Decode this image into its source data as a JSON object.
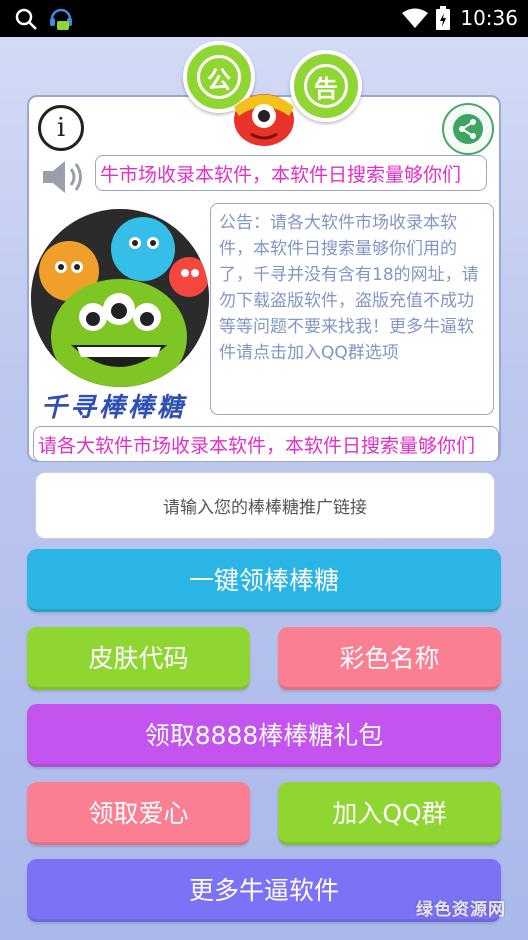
{
  "statusbar": {
    "time": "10:36",
    "icons": [
      "search-icon",
      "notification-bot-icon",
      "wifi-icon",
      "battery-icon"
    ]
  },
  "badges": {
    "left": "公",
    "right": "告"
  },
  "marquee_text": "请各大软件市场收录本软件，本软件日搜索量够你们用的了",
  "marquee_top_visible": "牛市场收录本软件，本软件日搜索量够你们",
  "marquee_bottom_visible": "请各大软件市场收录本软件，本软件日搜索量够你们",
  "logo": {
    "caption": "千寻棒棒糖"
  },
  "notice_text": "公告：请各大软件市场收录本软件，本软件日搜索量够你们用的了，千寻并没有含有18的网址，请勿下载盗版软件，盗版充值不成功等等问题不要来找我！更多牛逼软件请点击加入QQ群选项",
  "input": {
    "placeholder": "请输入您的棒棒糖推广链接"
  },
  "buttons": {
    "claim_candy": "一键领棒棒糖",
    "skin_code": "皮肤代码",
    "color_name": "彩色名称",
    "gift_pack": "领取8888棒棒糖礼包",
    "claim_love": "领取爱心",
    "join_qq": "加入QQ群",
    "more_apps": "更多牛逼软件"
  },
  "watermark": "绿色资源网",
  "colors": {
    "cyan": "#2bb5e5",
    "green": "#8fd633",
    "pink": "#fb7f93",
    "purple": "#c454ef",
    "violet": "#7b72f5",
    "marquee": "#e52ec9",
    "notice_text": "#8196c8"
  }
}
